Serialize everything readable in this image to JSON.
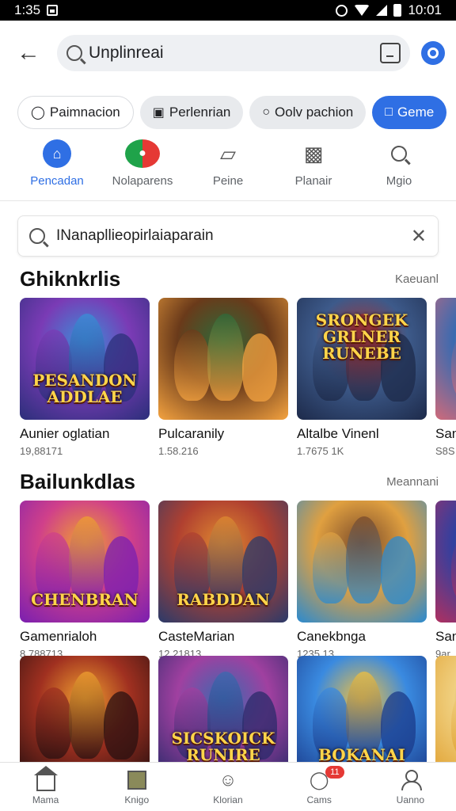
{
  "status_bar": {
    "time": "1:35",
    "clock": "10:01"
  },
  "search": {
    "query": "Unplinreai"
  },
  "chips": [
    {
      "label": "Paimnacion",
      "icon": "chat-bubble-icon",
      "style": "outlined"
    },
    {
      "label": "Perlenrian",
      "icon": "screen-icon",
      "style": "filled"
    },
    {
      "label": "Oolv pachion",
      "icon": "gamepad-icon",
      "style": "filled"
    },
    {
      "label": "Geme",
      "icon": "tag-icon",
      "style": "active"
    }
  ],
  "categories": [
    {
      "label": "Pencadan",
      "active": true
    },
    {
      "label": "Nolaparens",
      "active": false
    },
    {
      "label": "Peine",
      "active": false
    },
    {
      "label": "Planair",
      "active": false
    },
    {
      "label": "Mgio",
      "active": false
    }
  ],
  "filter": {
    "text": "INanapllieopirlaiaparain"
  },
  "sections": [
    {
      "title": "Ghiknkrlis",
      "more": "Kaeuanl",
      "cards": [
        {
          "name": "Aunier oglatian",
          "meta": "19,88171",
          "art": "PESANDON ADDLAE",
          "palette": [
            "#2b2f7a",
            "#7a3bb5",
            "#3a8fd8"
          ]
        },
        {
          "name": "Pulcaranily",
          "meta": "1.58.216",
          "art": "",
          "palette": [
            "#f4a340",
            "#6a3a1a",
            "#2d6a3a"
          ]
        },
        {
          "name": "Altalbe Vinenl",
          "meta": "1.7675 1K",
          "art": "SRONGEK GRLNER RUNEBE",
          "palette": [
            "#1d2a4a",
            "#3d5a8a",
            "#b03030"
          ]
        },
        {
          "name": "San",
          "meta": "S8S",
          "art": "",
          "palette": [
            "#d06a7a",
            "#3a6ab0",
            "#f0d0a0"
          ]
        }
      ]
    },
    {
      "title": "Bailunkdlas",
      "more": "Meannani",
      "cards": [
        {
          "name": "Gamenrialoh",
          "meta": "8,788713",
          "art": "CHENBRAN",
          "palette": [
            "#7a1fb0",
            "#d0408a",
            "#f0a030"
          ]
        },
        {
          "name": "CasteMarian",
          "meta": "12,21813",
          "art": "RABDDAN",
          "palette": [
            "#2a3a6a",
            "#b04030",
            "#e08a30"
          ]
        },
        {
          "name": "Canekbnga",
          "meta": "1235 13",
          "art": "",
          "palette": [
            "#2a8ad0",
            "#e0a040",
            "#7a4a2a"
          ]
        },
        {
          "name": "San",
          "meta": "9ar",
          "art": "",
          "palette": [
            "#b03060",
            "#3040a0",
            "#e0a030"
          ]
        }
      ]
    },
    {
      "title": "",
      "more": "",
      "cards": [
        {
          "name": "",
          "meta": "",
          "art": "",
          "palette": [
            "#2a1010",
            "#a03020",
            "#f0a030"
          ]
        },
        {
          "name": "",
          "meta": "",
          "art": "SICSKOICK RUNIRE",
          "palette": [
            "#2a2a6a",
            "#a040a0",
            "#3a6ab0"
          ]
        },
        {
          "name": "",
          "meta": "",
          "art": "BOKANAI",
          "palette": [
            "#1a3a8a",
            "#3a8ae0",
            "#f0c040"
          ]
        },
        {
          "name": "",
          "meta": "",
          "art": "",
          "palette": [
            "#e0a030",
            "#f0d080",
            "#3a3a3a"
          ]
        }
      ]
    }
  ],
  "bottom_nav": [
    {
      "label": "Mama",
      "icon": "home-icon"
    },
    {
      "label": "Knigo",
      "icon": "apps-icon"
    },
    {
      "label": "Klorian",
      "icon": "games-icon"
    },
    {
      "label": "Cams",
      "icon": "chat-icon",
      "badge": "11"
    },
    {
      "label": "Uanno",
      "icon": "profile-icon"
    }
  ]
}
